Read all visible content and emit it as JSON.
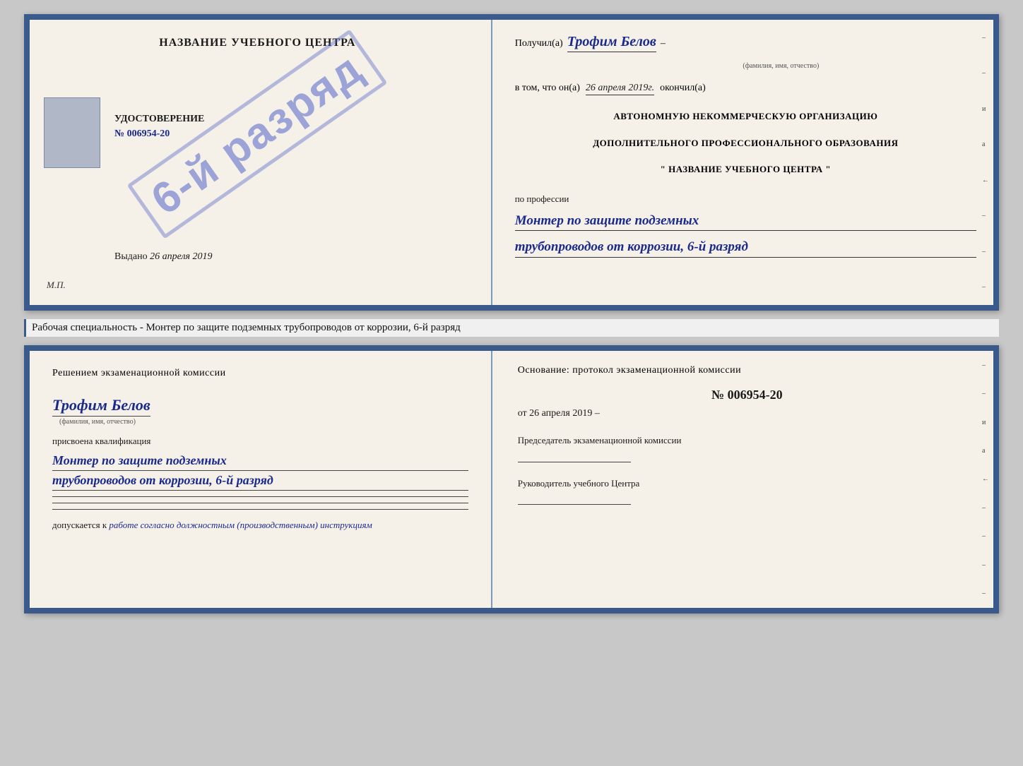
{
  "diploma": {
    "left": {
      "title": "НАЗВАНИЕ УЧЕБНОГО ЦЕНТРА",
      "stamp_text": "6-й разряд",
      "udostoverenie_label": "УДОСТОВЕРЕНИЕ",
      "udostoverenie_number": "№ 006954-20",
      "vydano_label": "Выдано",
      "vydano_date": "26 апреля 2019",
      "mp_label": "М.П."
    },
    "right": {
      "poluchil_label": "Получил(а)",
      "recipient_name": "Трофим Белов",
      "fio_small": "(фамилия, имя, отчество)",
      "v_tom_label": "в том, что он(а)",
      "date_handwritten": "26 апреля 2019г.",
      "okonchil_label": "окончил(а)",
      "org_line1": "АВТОНОМНУЮ НЕКОММЕРЧЕСКУЮ ОРГАНИЗАЦИЮ",
      "org_line2": "ДОПОЛНИТЕЛЬНОГО ПРОФЕССИОНАЛЬНОГО ОБРАЗОВАНИЯ",
      "org_name": "\"  НАЗВАНИЕ УЧЕБНОГО ЦЕНТРА  \"",
      "po_professii_label": "по профессии",
      "profession_line1": "Монтер по защите подземных",
      "profession_line2": "трубопроводов от коррозии, 6-й разряд"
    }
  },
  "specialty_text": "Рабочая специальность - Монтер по защите подземных трубопроводов от коррозии, 6-й разряд",
  "bottom_cert": {
    "left": {
      "decision_text": "Решением экзаменационной комиссии",
      "name_handwritten": "Трофим Белов",
      "fio_small": "(фамилия, имя, отчество)",
      "prisvoena_label": "присвоена квалификация",
      "qualification_line1": "Монтер по защите подземных",
      "qualification_line2": "трубопроводов от коррозии, 6-й разряд",
      "dopuskaetsya_label": "допускается к",
      "dopuskaetsya_text": "работе согласно должностным (производственным) инструкциям"
    },
    "right": {
      "osnovaniye_text": "Основание: протокол экзаменационной комиссии",
      "protocol_number": "№ 006954-20",
      "ot_label": "от",
      "protocol_date": "26 апреля 2019",
      "predsedatel_label": "Председатель экзаменационной комиссии",
      "rukovoditel_label": "Руководитель учебного Центра"
    }
  },
  "edge_marks": {
    "items": [
      "–",
      "–",
      "и",
      "а",
      "←",
      "–",
      "–",
      "–",
      "–"
    ]
  }
}
